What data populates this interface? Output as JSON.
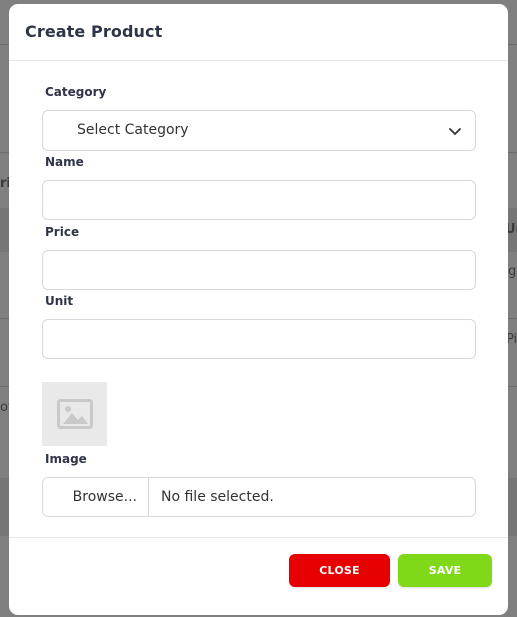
{
  "modal": {
    "title": "Create Product",
    "fields": {
      "category": {
        "label": "Category",
        "value": "Select Category"
      },
      "name": {
        "label": "Name",
        "value": ""
      },
      "price": {
        "label": "Price",
        "value": ""
      },
      "unit": {
        "label": "Unit",
        "value": ""
      },
      "image": {
        "label": "Image",
        "browse_label": "Browse...",
        "file_status": "No file selected."
      }
    },
    "buttons": {
      "close_label": "CLOSE",
      "save_label": "SAVE"
    }
  },
  "background": {
    "fragments": {
      "f1": "ri",
      "f2": "Ur",
      "f3": "g",
      "f4": "Pi",
      "f5": "of"
    }
  },
  "colors": {
    "close": "#e60000",
    "save": "#80d918",
    "title": "#2f3547"
  }
}
